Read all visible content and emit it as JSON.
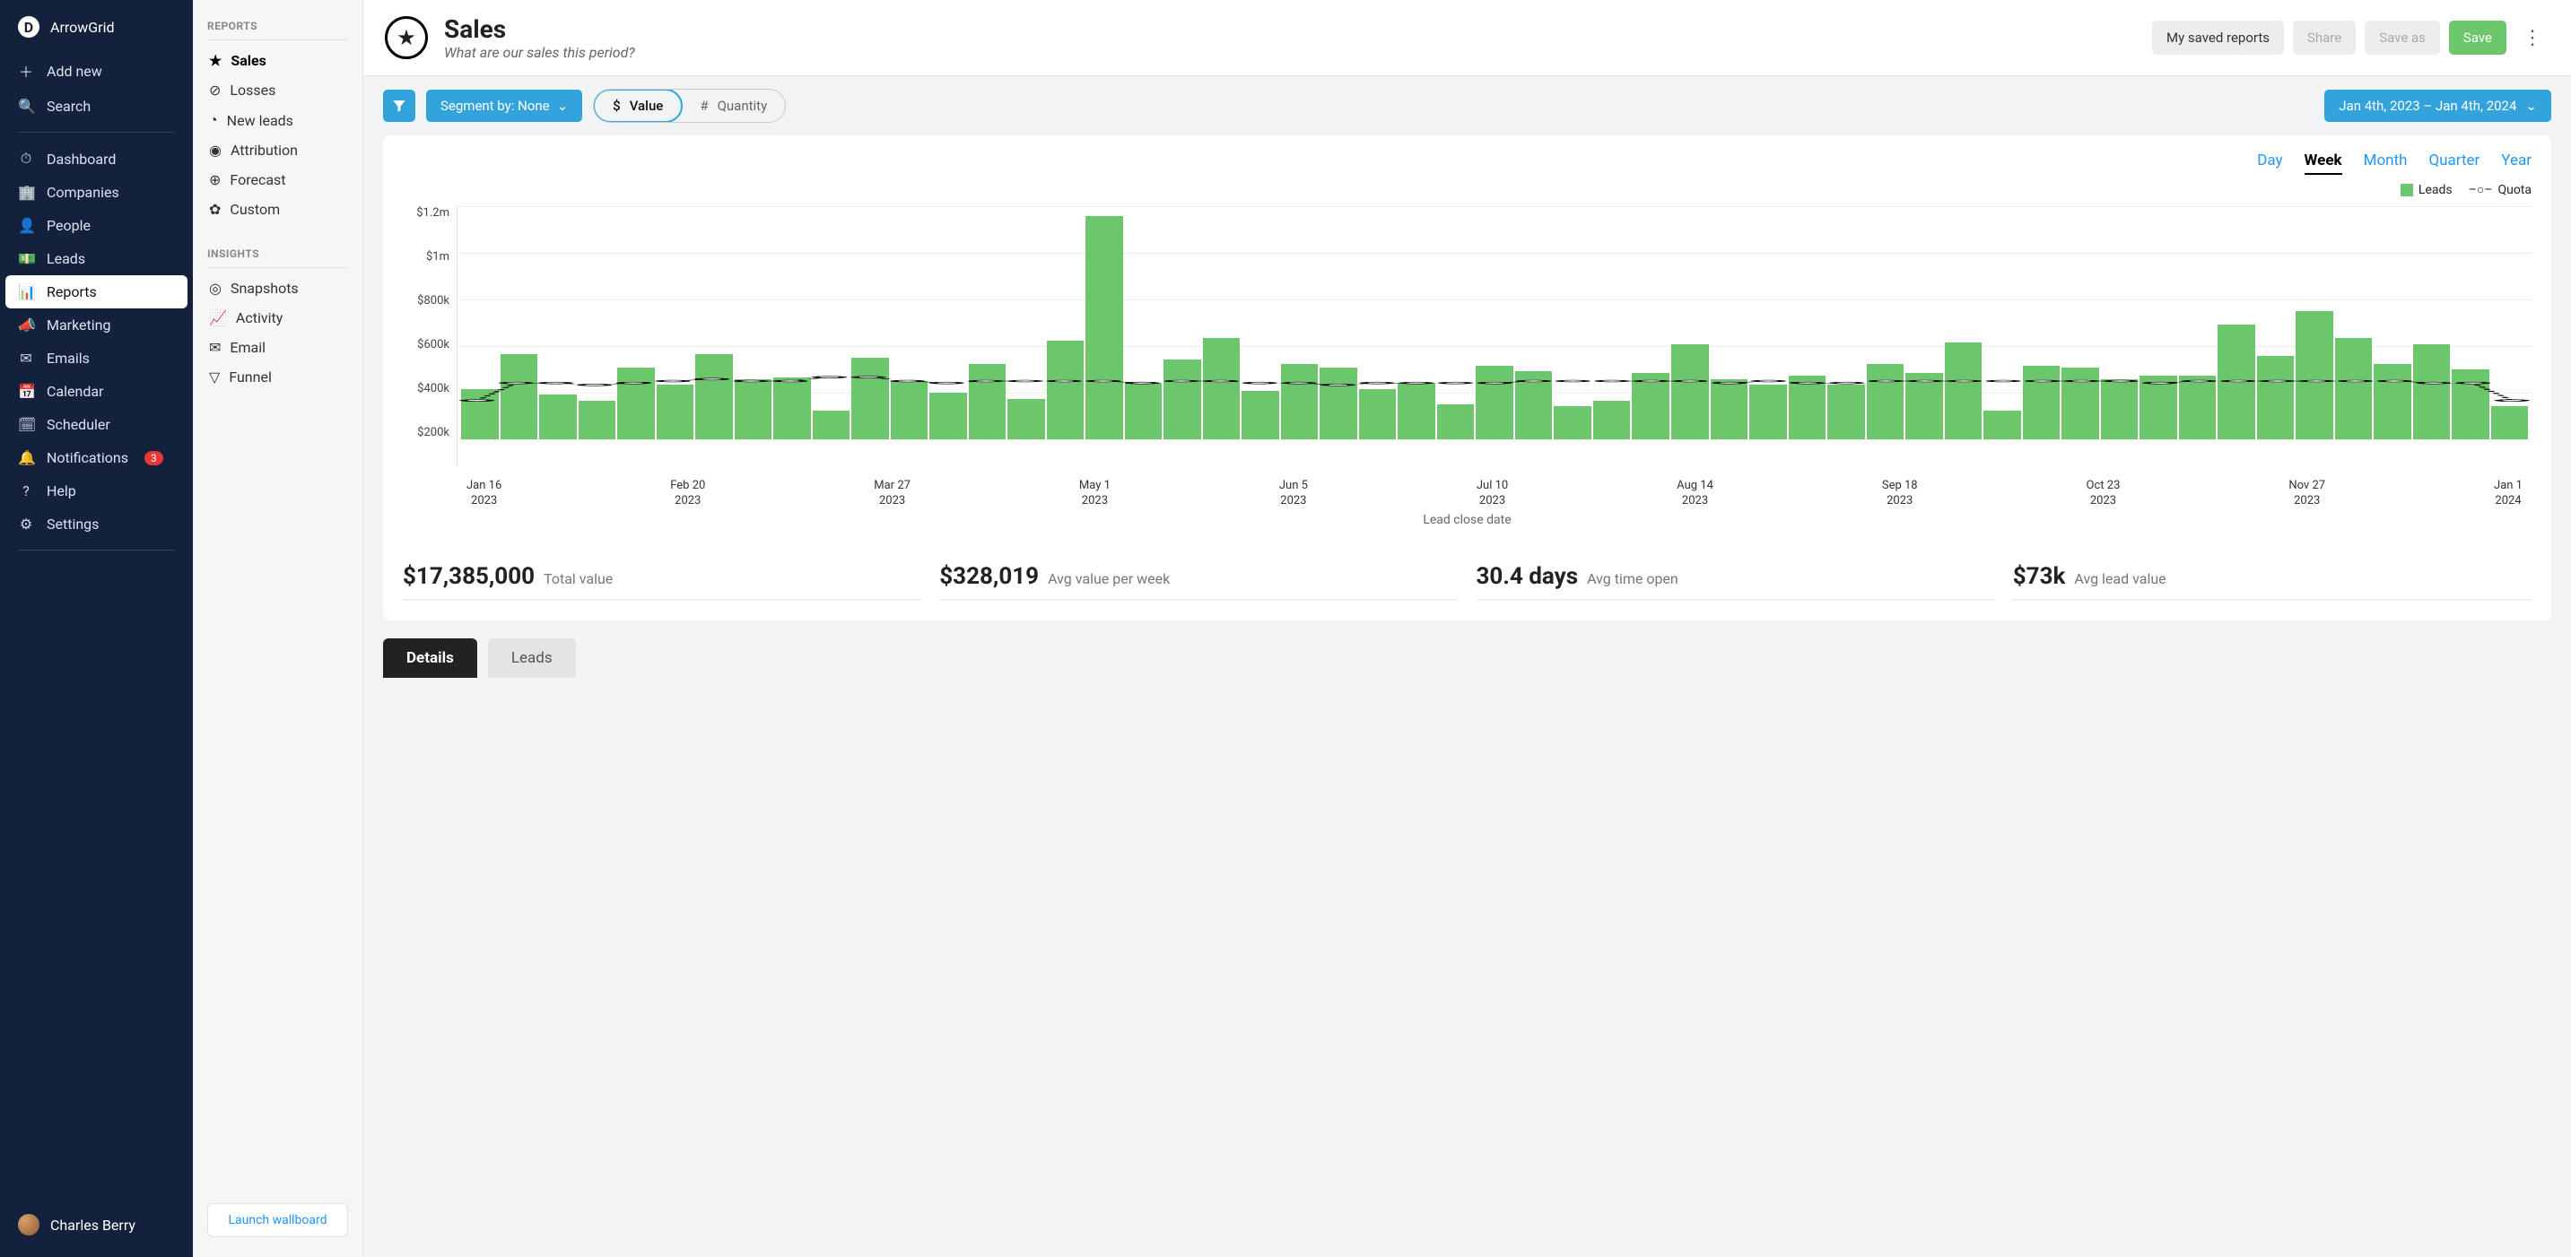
{
  "brand": "ArrowGrid",
  "sidebar": {
    "add_new": "Add new",
    "search": "Search",
    "items": [
      "Dashboard",
      "Companies",
      "People",
      "Leads",
      "Reports",
      "Marketing",
      "Emails",
      "Calendar",
      "Scheduler",
      "Notifications",
      "Help",
      "Settings"
    ],
    "active": "Reports",
    "notification_badge": "3",
    "user": "Charles Berry"
  },
  "panel2": {
    "reports_title": "REPORTS",
    "reports": [
      "Sales",
      "Losses",
      "New leads",
      "Attribution",
      "Forecast",
      "Custom"
    ],
    "reports_active": "Sales",
    "insights_title": "INSIGHTS",
    "insights": [
      "Snapshots",
      "Activity",
      "Email",
      "Funnel"
    ],
    "launch": "Launch wallboard"
  },
  "header": {
    "title": "Sales",
    "subtitle": "What are our sales this period?",
    "my_saved": "My saved reports",
    "share": "Share",
    "save_as": "Save as",
    "save": "Save"
  },
  "toolbar": {
    "segment": "Segment by: None",
    "value": "Value",
    "quantity": "Quantity",
    "date_range": "Jan 4th, 2023 – Jan 4th, 2024"
  },
  "granularity": {
    "options": [
      "Day",
      "Week",
      "Month",
      "Quarter",
      "Year"
    ],
    "active": "Week"
  },
  "legend": {
    "leads": "Leads",
    "quota": "Quota"
  },
  "x_label": "Lead close date",
  "stats": [
    {
      "v": "$17,385,000",
      "l": "Total value"
    },
    {
      "v": "$328,019",
      "l": "Avg value per week"
    },
    {
      "v": "30.4 days",
      "l": "Avg time open"
    },
    {
      "v": "$73k",
      "l": "Avg lead value"
    }
  ],
  "tabs": {
    "details": "Details",
    "leads": "Leads",
    "active": "Details"
  },
  "chart_data": {
    "type": "bar",
    "ylabel": "",
    "xlabel": "Lead close date",
    "ylim": [
      0,
      1200000
    ],
    "y_ticks": [
      "$1.2m",
      "$1m",
      "$800k",
      "$600k",
      "$400k",
      "$200k"
    ],
    "x_ticks": [
      {
        "l1": "Jan 16",
        "l2": "2023"
      },
      {
        "l1": "Feb 20",
        "l2": "2023"
      },
      {
        "l1": "Mar 27",
        "l2": "2023"
      },
      {
        "l1": "May 1",
        "l2": "2023"
      },
      {
        "l1": "Jun 5",
        "l2": "2023"
      },
      {
        "l1": "Jul 10",
        "l2": "2023"
      },
      {
        "l1": "Aug 14",
        "l2": "2023"
      },
      {
        "l1": "Sep 18",
        "l2": "2023"
      },
      {
        "l1": "Oct 23",
        "l2": "2023"
      },
      {
        "l1": "Nov 27",
        "l2": "2023"
      },
      {
        "l1": "Jan 1",
        "l2": "2024"
      }
    ],
    "series": [
      {
        "name": "Leads",
        "type": "bar",
        "values": [
          260000,
          440000,
          230000,
          200000,
          370000,
          280000,
          440000,
          310000,
          320000,
          150000,
          420000,
          300000,
          240000,
          390000,
          210000,
          510000,
          1150000,
          290000,
          410000,
          520000,
          250000,
          390000,
          370000,
          260000,
          290000,
          180000,
          380000,
          350000,
          170000,
          200000,
          340000,
          490000,
          310000,
          280000,
          330000,
          280000,
          390000,
          340000,
          500000,
          150000,
          380000,
          370000,
          310000,
          330000,
          330000,
          590000,
          430000,
          660000,
          520000,
          390000,
          490000,
          360000,
          170000
        ]
      },
      {
        "name": "Quota",
        "type": "line",
        "values": [
          200000,
          290000,
          290000,
          280000,
          290000,
          300000,
          310000,
          300000,
          300000,
          320000,
          320000,
          300000,
          290000,
          300000,
          300000,
          300000,
          300000,
          290000,
          300000,
          300000,
          290000,
          290000,
          280000,
          290000,
          290000,
          290000,
          290000,
          300000,
          300000,
          300000,
          300000,
          300000,
          290000,
          300000,
          290000,
          290000,
          300000,
          300000,
          300000,
          300000,
          300000,
          300000,
          300000,
          290000,
          300000,
          300000,
          300000,
          300000,
          300000,
          300000,
          290000,
          290000,
          200000
        ]
      }
    ]
  }
}
